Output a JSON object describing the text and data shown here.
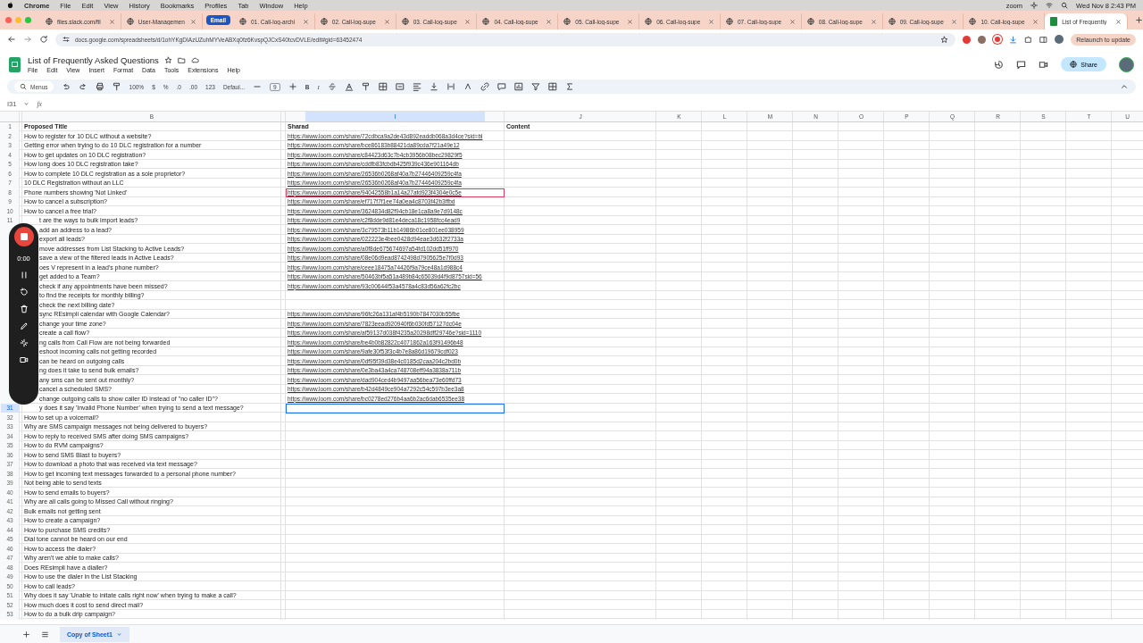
{
  "menubar": {
    "app": "Chrome",
    "items": [
      "File",
      "Edit",
      "View",
      "History",
      "Bookmarks",
      "Profiles",
      "Tab",
      "Window",
      "Help"
    ],
    "status": "zoom",
    "clock": "Wed Nov 8  2:43 PM"
  },
  "tabs": [
    {
      "kind": "page",
      "label": "files.slack.com/fil",
      "selected": false
    },
    {
      "kind": "page",
      "label": "User-Managemen",
      "selected": false
    },
    {
      "kind": "group",
      "label": "Email"
    },
    {
      "kind": "page",
      "label": "01. Call-log-archi",
      "selected": false
    },
    {
      "kind": "page",
      "label": "02. Call-log-supe",
      "selected": false
    },
    {
      "kind": "page",
      "label": "03. Call-log-supe",
      "selected": false
    },
    {
      "kind": "page",
      "label": "04. Call-log-supe",
      "selected": false
    },
    {
      "kind": "page",
      "label": "05. Call-log-supe",
      "selected": false
    },
    {
      "kind": "page",
      "label": "06. Call-log-supe",
      "selected": false
    },
    {
      "kind": "page",
      "label": "07. Call-log-supe",
      "selected": false
    },
    {
      "kind": "page",
      "label": "08. Call-log-supe",
      "selected": false
    },
    {
      "kind": "page",
      "label": "09. Call-log-supe",
      "selected": false
    },
    {
      "kind": "page",
      "label": "10. Call-log-supe",
      "selected": false
    },
    {
      "kind": "sheet",
      "label": "List of Frequently",
      "selected": true
    }
  ],
  "address": "docs.google.com/spreadsheets/d/1ohYKgDIAzUZuhMYVeABXq0fz6KvspQJCxS40tcvDVLE/edit#gid=63452474",
  "relaunch": "Relaunch to update",
  "doc": {
    "title": "List of Frequently Asked Questions",
    "menus": [
      "File",
      "Edit",
      "View",
      "Insert",
      "Format",
      "Data",
      "Tools",
      "Extensions",
      "Help"
    ],
    "share": "Share"
  },
  "toolbar": {
    "search": "Menus",
    "zoom": "100%",
    "formats": [
      "$",
      "%",
      ".0",
      ".00",
      "123"
    ],
    "font": "Defaul...",
    "size": "9",
    "bold": "B",
    "italic": "I"
  },
  "formula_bar": {
    "cell": "I31",
    "fx": "fx"
  },
  "columns": [
    {
      "label": "B",
      "selected": false
    },
    {
      "label": "I",
      "selected": true
    },
    {
      "label": "J",
      "selected": false
    },
    {
      "label": "K",
      "selected": false
    },
    {
      "label": "L",
      "selected": false
    },
    {
      "label": "M",
      "selected": false
    },
    {
      "label": "N",
      "selected": false
    },
    {
      "label": "O",
      "selected": false
    },
    {
      "label": "P",
      "selected": false
    },
    {
      "label": "Q",
      "selected": false
    },
    {
      "label": "R",
      "selected": false
    },
    {
      "label": "S",
      "selected": false
    },
    {
      "label": "T",
      "selected": false
    },
    {
      "label": "U",
      "selected": false
    }
  ],
  "rows": [
    {
      "kind": "header",
      "number": "1",
      "title": "Proposed Title",
      "link": "Sharad",
      "content": "Content",
      "selected": false,
      "marked": false
    },
    {
      "kind": "data",
      "number": "2",
      "title": "How to register for 10 DLC without a website?",
      "link": "https://www.loom.com/share/72cdbca9a2de43d892eaddb068a3d4ce?sid=bl",
      "selected": false,
      "marked": false
    },
    {
      "kind": "data",
      "number": "3",
      "title": "Getting error when trying to do 10 DLC registration for a number",
      "link": "https://www.loom.com/share/bce86183b88421da89cda7f21a49e12",
      "selected": false,
      "marked": false
    },
    {
      "kind": "data",
      "number": "4",
      "title": "How to get updates on 10 DLC registration?",
      "link": "https://www.loom.com/share/c84423d63c7b4cb3956b08bec29829f5",
      "selected": false,
      "marked": false
    },
    {
      "kind": "data",
      "number": "5",
      "title": "How long does 10 DLC registration take?",
      "link": "https://www.loom.com/share/cddfb83fcbdb425f939c436e901164db",
      "selected": false,
      "marked": false
    },
    {
      "kind": "data",
      "number": "6",
      "title": "How to complete 10 DLC registration as a sole proprietor?",
      "link": "https://www.loom.com/share/26536b0268af40a7b27446409259c4fa",
      "selected": false,
      "marked": false
    },
    {
      "kind": "data",
      "number": "7",
      "title": "10 DLC Registration without an LLC",
      "link": "https://www.loom.com/share/26536b0268af40a7b27446409259c4fa",
      "selected": false,
      "marked": false
    },
    {
      "kind": "data",
      "number": "8",
      "title": "Phone numbers showing 'Not Linked'",
      "link": "https://www.loom.com/share/94042558b1a14a27afd923f4304e0c5e",
      "selected": false,
      "marked": true
    },
    {
      "kind": "data",
      "number": "9",
      "title": "How to cancel a subscription?",
      "link": "https://www.loom.com/share/ef717f7f1ee74a0ea4c8703f42b3ffbd",
      "selected": false,
      "marked": false
    },
    {
      "kind": "data",
      "number": "10",
      "title": "How to cancel a free trial?",
      "link": "https://www.loom.com/share/3624834d82f94cb18e1ca8a9e7d9148c",
      "selected": false,
      "marked": false
    },
    {
      "kind": "data",
      "number": "11",
      "title": "t are the ways to bulk import leads?",
      "link": "https://www.loom.com/share/c2f8dde9d81e4deca18c1958fcc4ead9",
      "selected": false,
      "marked": false
    },
    {
      "kind": "data",
      "title": "add an address to a lead?",
      "link": "https://www.loom.com/share/3c79573b11b14986b01ce801ee038959",
      "selected": false,
      "marked": false
    },
    {
      "kind": "data",
      "title": "export all leads?",
      "link": "https://www.loom.com/share/022223e4bee0428d94eae3d632f2733a",
      "selected": false,
      "marked": false
    },
    {
      "kind": "data",
      "title": "move addresses from List Stacking to Active Leads?",
      "link": "https://www.loom.com/share/a0f8de675674697a54fd102dd51ff970",
      "selected": false,
      "marked": false
    },
    {
      "kind": "data",
      "title": "save a view of the filtered leads in Active Leads?",
      "link": "https://www.loom.com/share/08e06d9ead8742498d7905625e7f0d93",
      "selected": false,
      "marked": false
    },
    {
      "kind": "data",
      "title": "oes V represent in a lead's phone number?",
      "link": "https://www.loom.com/share/ceee18475a74426f9a79ce48a1d988c4",
      "selected": false,
      "marked": false
    },
    {
      "kind": "data",
      "title": "get added to a Team?",
      "link": "https://www.loom.com/share/50463bf5a51a489b84c65039d4f9d8757sid=56",
      "selected": false,
      "marked": false
    },
    {
      "kind": "data",
      "title": "check if any appointments have been missed?",
      "link": "https://www.loom.com/share/93c00644f53a4578a4c83d56a62fc2bc",
      "selected": false,
      "marked": false
    },
    {
      "kind": "data",
      "title": "to find the receipts for monthly billing?",
      "selected": false,
      "marked": false
    },
    {
      "kind": "data",
      "title": "check the next billing date?",
      "selected": false,
      "marked": false
    },
    {
      "kind": "data",
      "title": "sync REsimpli calendar with Google Calendar?",
      "link": "https://www.loom.com/share/96fc26a131af4b5190b7847030b55fbe",
      "selected": false,
      "marked": false
    },
    {
      "kind": "data",
      "title": "change your time zone?",
      "link": "https://www.loom.com/share/7823eead920940f6b030fd57127dc04e",
      "selected": false,
      "marked": false
    },
    {
      "kind": "data",
      "title": "create a call flow?",
      "link": "https://www.loom.com/share/af59137d038f4235a20298dff29746e?sid=1110",
      "selected": false,
      "marked": false
    },
    {
      "kind": "data",
      "title": "ng calls from Call Flow are not being forwarded",
      "link": "https://www.loom.com/share/be4b0b82822c4071862a163f91496b48",
      "selected": false,
      "marked": false
    },
    {
      "kind": "data",
      "title": "eshoot incoming calls not getting recorded",
      "link": "https://www.loom.com/share/9afe30f53f3c4b7e8a86d19679cdf023",
      "selected": false,
      "marked": false
    },
    {
      "kind": "data",
      "title": "can be heard on outgoing calls",
      "link": "https://www.loom.com/share/0df95f39d38e4c0185d2caa204c2bd0b",
      "selected": false,
      "marked": false
    },
    {
      "kind": "data",
      "title": "ng does it take to send bulk emails?",
      "link": "https://www.loom.com/share/0e3ba43a4ca748708eff94a3838a711b",
      "selected": false,
      "marked": false
    },
    {
      "kind": "data",
      "title": "any sms can be sent out monthly?",
      "link": "https://www.loom.com/share/dad904ced4b9497aa56bea73e60ffd73",
      "selected": false,
      "marked": false
    },
    {
      "kind": "data",
      "title": "cancel a scheduled SMS?",
      "link": "https://www.loom.com/share/b42d4849ce904a7292c54c597b3ee3a8",
      "selected": false,
      "marked": false
    },
    {
      "kind": "data",
      "title": "change outgoing calls to show caller ID instead of  \"no caller ID\"?",
      "link": "https://www.loom.com/share/bc0278ed276b4aa6b2ac6dab6535ee38",
      "selected": false,
      "marked": false
    },
    {
      "kind": "data",
      "number": "31",
      "title": "y does it say 'Invalid Phone Number' when trying to send a text message?",
      "selected": true,
      "marked": false
    },
    {
      "kind": "data",
      "number": "32",
      "title": "How to set up a voicemail?",
      "selected": false,
      "marked": false
    },
    {
      "kind": "data",
      "number": "33",
      "title": "Why are SMS campaign messages not being delivered to buyers?",
      "selected": false,
      "marked": false
    },
    {
      "kind": "data",
      "number": "34",
      "title": "How to reply to received SMS after doing SMS campaigns?",
      "selected": false,
      "marked": false
    },
    {
      "kind": "data",
      "number": "35",
      "title": "How to do RVM campaigns?",
      "selected": false,
      "marked": false
    },
    {
      "kind": "data",
      "number": "36",
      "title": "How to send SMS Blast to buyers?",
      "selected": false,
      "marked": false
    },
    {
      "kind": "data",
      "number": "37",
      "title": "How to download a photo that was received via text message?",
      "selected": false,
      "marked": false
    },
    {
      "kind": "data",
      "number": "38",
      "title": "How to get incoming text messages forwarded to a personal phone number?",
      "selected": false,
      "marked": false
    },
    {
      "kind": "data",
      "number": "39",
      "title": "Not being able to send texts",
      "selected": false,
      "marked": false
    },
    {
      "kind": "data",
      "number": "40",
      "title": "How to send emails to buyers?",
      "selected": false,
      "marked": false
    },
    {
      "kind": "data",
      "number": "41",
      "title": "Why are all calls going to Missed Call without ringing?",
      "selected": false,
      "marked": false
    },
    {
      "kind": "data",
      "number": "42",
      "title": "Bulk emails not getting sent",
      "selected": false,
      "marked": false
    },
    {
      "kind": "data",
      "number": "43",
      "title": "How to create a campaign?",
      "selected": false,
      "marked": false
    },
    {
      "kind": "data",
      "number": "44",
      "title": "How to purchase SMS credits?",
      "selected": false,
      "marked": false
    },
    {
      "kind": "data",
      "number": "45",
      "title": "Dial tone cannot be heard on our end",
      "selected": false,
      "marked": false
    },
    {
      "kind": "data",
      "number": "46",
      "title": "How to access the dialer?",
      "selected": false,
      "marked": false
    },
    {
      "kind": "data",
      "number": "47",
      "title": "Why aren't we able to make calls?",
      "selected": false,
      "marked": false
    },
    {
      "kind": "data",
      "number": "48",
      "title": "Does REsimpli have a dialler?",
      "selected": false,
      "marked": false
    },
    {
      "kind": "data",
      "number": "49",
      "title": "How to use the dialer in the List Stacking",
      "selected": false,
      "marked": false
    },
    {
      "kind": "data",
      "number": "50",
      "title": "How to call leads?",
      "selected": false,
      "marked": false
    },
    {
      "kind": "data",
      "number": "51",
      "title": "Why does it say 'Unable to initate calls right now' when trying to make a call?",
      "selected": false,
      "marked": false
    },
    {
      "kind": "data",
      "number": "52",
      "title": "How much does it cost to send direct mail?",
      "selected": false,
      "marked": false
    },
    {
      "kind": "data",
      "number": "53",
      "title": "How to do a bulk drip campaign?",
      "selected": false,
      "marked": false
    }
  ],
  "recorder": {
    "time": "0:00"
  },
  "sheet_tabs": [
    {
      "label": "Copy of Sheet1",
      "selected": true
    }
  ]
}
